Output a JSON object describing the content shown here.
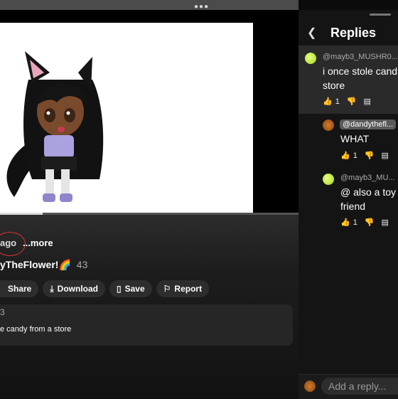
{
  "video": {
    "meta_age": "ago",
    "more_label": "...more",
    "channel_name": "yTheFlower!🌈",
    "channel_count": "43"
  },
  "actions": [
    {
      "label": "Share",
      "icon": "share-icon"
    },
    {
      "label": "Download",
      "icon": "download-icon"
    },
    {
      "label": "Save",
      "icon": "save-icon"
    },
    {
      "label": "Report",
      "icon": "flag-icon"
    }
  ],
  "comments_preview": {
    "count": "3",
    "text": "e candy from a store"
  },
  "replies_panel": {
    "back_icon": "chevron-left-icon",
    "title": "Replies",
    "comments": [
      {
        "author": "@mayb3_MUSHR0...",
        "lines": [
          "i once stole cand",
          "store"
        ],
        "likes": "1"
      },
      {
        "author": "@dandythefl...",
        "lines": [
          "WHAT"
        ],
        "likes": "1"
      },
      {
        "author": "@mayb3_MU...",
        "lines": [
          "@ also a toy f",
          "friend"
        ],
        "likes": "1"
      }
    ],
    "reply_placeholder": "Add a reply..."
  }
}
